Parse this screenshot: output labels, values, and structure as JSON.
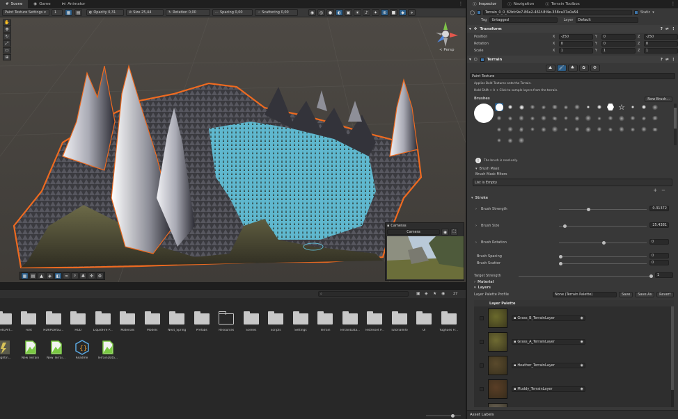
{
  "tabs": [
    {
      "label": "Scene",
      "icon": "hash-icon",
      "active": true
    },
    {
      "label": "Game",
      "icon": "gamepad-icon",
      "active": false
    },
    {
      "label": "Animator",
      "icon": "animator-icon",
      "active": false
    }
  ],
  "scene_toolbar": {
    "mode": "Paint Texture Settings",
    "brush_num": "1",
    "opacity": "Opacity 0,31",
    "size": "Size 25,44",
    "rotation": "Rotation 0,00",
    "spacing": "Spacing 0,00",
    "scattering": "Scattering 0,00"
  },
  "gizmo": {
    "persp": "< Persp"
  },
  "cameras": {
    "title": "Cameras",
    "selected": "Camera"
  },
  "project": {
    "search_placeholder": "",
    "count": "27",
    "folders": [
      "Assets/Art...",
      "Font",
      "HDRPDefau...",
      "HUD",
      "LiquidFire P...",
      "Materials",
      "Models",
      "Next_Spring",
      "Prefabs",
      "Resources",
      "Scenes",
      "Scripts",
      "Settings",
      "Terrain",
      "TerrainData...",
      "TestAsset P...",
      "TutorialInfo",
      "UI",
      "Yughues Fr..."
    ],
    "assets": [
      {
        "label": "Lightin...",
        "type": "lighting"
      },
      {
        "label": "New Terrain",
        "type": "terrain"
      },
      {
        "label": "New Terrai...",
        "type": "terrain"
      },
      {
        "label": "Readme",
        "type": "readme"
      },
      {
        "label": "TerrainData...",
        "type": "terrain"
      }
    ]
  },
  "inspector": {
    "tabs": [
      {
        "label": "Inspector",
        "active": true
      },
      {
        "label": "Navigation",
        "active": false
      },
      {
        "label": "Terrain Toolbox",
        "active": false
      }
    ],
    "object_name": "Terrain_0_0_82bfc9e7-86a2-461f-8f4e-358ca37a0a54",
    "static_label": "Static",
    "tag_label": "Tag",
    "tag_value": "Untagged",
    "layer_label": "Layer",
    "layer_value": "Default",
    "transform": {
      "title": "Transform",
      "rows": [
        {
          "label": "Position",
          "x": "-250",
          "y": "0",
          "z": "-250"
        },
        {
          "label": "Rotation",
          "x": "0",
          "y": "0",
          "z": "0"
        },
        {
          "label": "Scale",
          "x": "1",
          "y": "1",
          "z": "1"
        }
      ]
    },
    "terrain": {
      "title": "Terrain",
      "tool": "Paint Texture",
      "desc1": "Applies Bold Textures onto the Terrain.",
      "desc2": "Hold Shift + A + Click to sample layers from the terrain.",
      "brushes_label": "Brushes",
      "new_brush": "New Brush...",
      "readonly": "The brush is read-only.",
      "brush_mask": "Brush Mask",
      "brush_mask_filters": "Brush Mask Filters",
      "list_empty": "List is Empty",
      "stroke": "Stroke",
      "brush_strength": {
        "label": "Brush Strength",
        "value": "0.31372"
      },
      "brush_size": {
        "label": "Brush Size",
        "value": "25.4381"
      },
      "brush_rotation": {
        "label": "Brush Rotation",
        "value": "0"
      },
      "brush_spacing": {
        "label": "Brush Spacing",
        "value": "0"
      },
      "brush_scatter": {
        "label": "Brush Scatter",
        "value": "0"
      },
      "target_strength": {
        "label": "Target Strength",
        "value": "1"
      },
      "material": "Material",
      "layers": "Layers",
      "layer_palette_profile": "Layer Palette Profile",
      "palette_value": "None (Terrain Palette)",
      "save": "Save",
      "save_as": "Save As",
      "revert": "Revert",
      "layer_palette": "Layer Palette",
      "terrain_layers": [
        {
          "name": "Grass_B_TerrainLayer",
          "color": "#6b6a2c"
        },
        {
          "name": "Grass_A_TerrainLayer",
          "color": "#6f6b32"
        },
        {
          "name": "Heather_TerrainLayer",
          "color": "#5a4a2c"
        },
        {
          "name": "Muddy_TerrainLayer",
          "color": "#5a3e26"
        },
        {
          "name": "Rock_TerrainLayer",
          "color": "#6d6558"
        }
      ]
    },
    "asset_labels": "Asset Labels"
  }
}
